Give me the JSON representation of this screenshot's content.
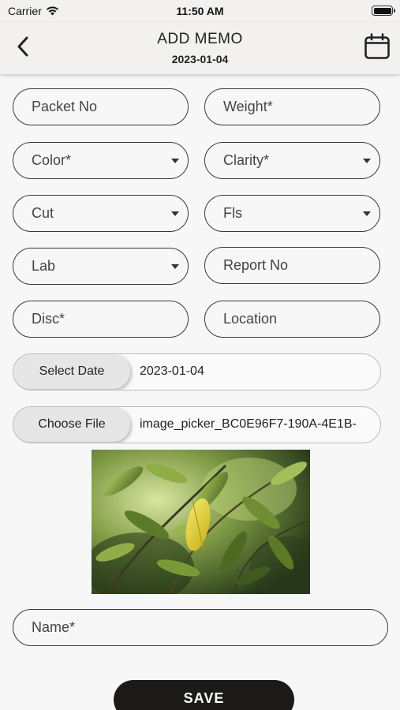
{
  "status_bar": {
    "carrier": "Carrier",
    "time": "11:50 AM",
    "battery_level": 1.0
  },
  "header": {
    "title": "ADD MEMO",
    "date": "2023-01-04",
    "back_icon": "chevron-left-icon",
    "calendar_icon": "calendar-icon"
  },
  "form": {
    "packet_no": {
      "placeholder": "Packet No"
    },
    "weight": {
      "placeholder": "Weight*"
    },
    "color": {
      "placeholder": "Color*"
    },
    "clarity": {
      "placeholder": "Clarity*"
    },
    "cut": {
      "placeholder": "Cut"
    },
    "fls": {
      "placeholder": "Fls"
    },
    "lab": {
      "placeholder": "Lab"
    },
    "report_no": {
      "placeholder": "Report No"
    },
    "disc": {
      "placeholder": "Disc*"
    },
    "location": {
      "placeholder": "Location"
    },
    "select_date": {
      "button_label": "Select Date",
      "value": "2023-01-04"
    },
    "choose_file": {
      "button_label": "Choose File",
      "value": "image_picker_BC0E96F7-190A-4E1B-"
    },
    "name": {
      "placeholder": "Name*"
    }
  },
  "save_button": {
    "label": "SAVE"
  },
  "colors": {
    "header_bg": "#f2f1ef",
    "page_bg": "#f7f7f7",
    "border": "#3a3a3a",
    "save_bg": "#1c1a18"
  }
}
